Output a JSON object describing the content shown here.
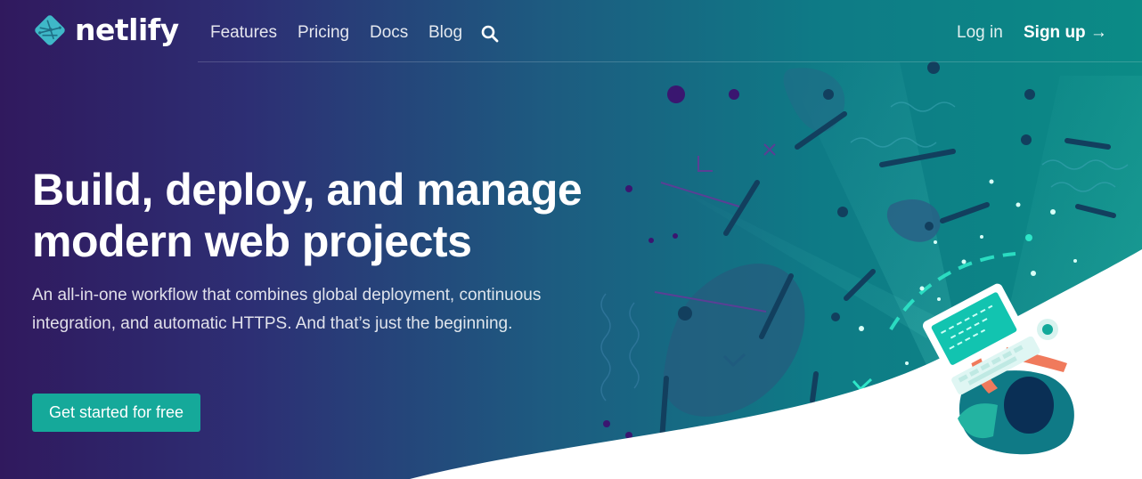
{
  "brand": {
    "name": "netlify",
    "icon": "netlify-logo-icon"
  },
  "nav": {
    "links": [
      {
        "label": "Features"
      },
      {
        "label": "Pricing"
      },
      {
        "label": "Docs"
      },
      {
        "label": "Blog"
      }
    ],
    "search_icon": "search-icon",
    "login_label": "Log in",
    "signup_label": "Sign up →"
  },
  "hero": {
    "headline_line1": "Build, deploy, and manage",
    "headline_line2": "modern web projects",
    "subtitle": "An all-in-one workflow that combines global deployment, continuous integration, and automatic HTTPS. And that’s just the beginning.",
    "cta_label": "Get started for free"
  },
  "colors": {
    "gradient_start": "#30195e",
    "gradient_end": "#0b8b86",
    "accent_teal": "#15a99a",
    "bright_teal": "#2ee6c8"
  }
}
